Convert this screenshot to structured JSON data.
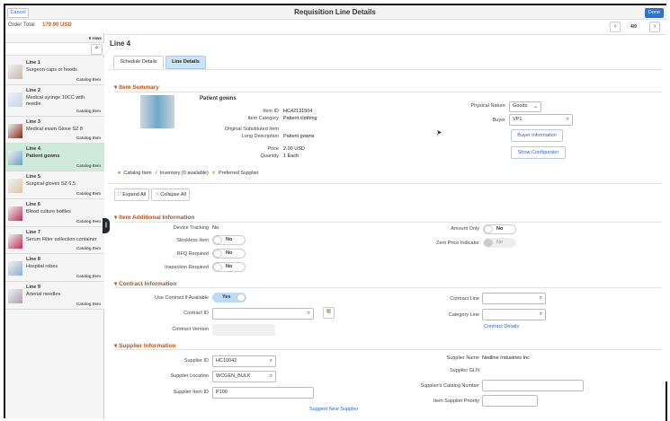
{
  "header": {
    "cancel": "Cancel",
    "title": "Requisition Line Details",
    "done": "Done"
  },
  "order_total": {
    "label": "Order Total",
    "value": "179.90 USD"
  },
  "list": {
    "rows": "9 rows",
    "items": [
      {
        "line": "Line 1",
        "desc": "Surgeon caps or hoods",
        "type": "Catalog Item"
      },
      {
        "line": "Line 2",
        "desc": "Medical syringe 10CC with needle",
        "type": "Catalog Item"
      },
      {
        "line": "Line 3",
        "desc": "Medical exam Glove SZ 8",
        "type": "Catalog Item"
      },
      {
        "line": "Line 4",
        "desc": "Patient gowns",
        "type": "Catalog Item"
      },
      {
        "line": "Line 5",
        "desc": "Surgical gloves SZ 6.5",
        "type": "Catalog Item"
      },
      {
        "line": "Line 6",
        "desc": "Blood culture bottles",
        "type": "Catalog Item"
      },
      {
        "line": "Line 7",
        "desc": "Serum Filter collection container",
        "type": "Catalog Item"
      },
      {
        "line": "Line 8",
        "desc": "Hospital robes",
        "type": "Catalog Item"
      },
      {
        "line": "Line 9",
        "desc": "Arterial needles",
        "type": "Catalog Item"
      }
    ]
  },
  "main": {
    "title": "Line 4",
    "pager": "4/9",
    "tabs": [
      "Schedule Details",
      "Line Details"
    ]
  },
  "summary": {
    "section": "Item Summary",
    "name": "Patient gowns",
    "item_id_label": "Item ID",
    "item_id": "HC42131504",
    "category_label": "Item Category",
    "category": "Patient clothing",
    "orig_label": "Original Substituted Item",
    "longdesc_label": "Long Description",
    "longdesc": "Patient gowns",
    "price_label": "Price",
    "price": "2.00 USD",
    "qty_label": "Quantity",
    "qty": "1 Each",
    "nature_label": "Physical Nature",
    "nature": "Goods",
    "buyer_label": "Buyer",
    "buyer": "VP1",
    "buyer_info": "Buyer Information",
    "show_config": "Show Configurator",
    "legend": [
      "Catalog Item",
      "Inventory (0 available)",
      "Preferred Supplier"
    ],
    "expand": "Expand All",
    "collapse": "Collapse All"
  },
  "additional": {
    "section": "Item Additional Information",
    "device_label": "Device Tracking",
    "device": "No",
    "stockless_label": "Stockless Item",
    "stockless": "No",
    "rfq_label": "RFQ Required",
    "rfq": "No",
    "insp_label": "Inspection Required",
    "insp": "No",
    "amount_label": "Amount Only",
    "amount": "No",
    "zero_label": "Zero Price Indicator",
    "zero": "No"
  },
  "contract": {
    "section": "Contract Information",
    "use_label": "Use Contract if Available",
    "use": "Yes",
    "id_label": "Contract ID",
    "id": "",
    "version_label": "Contract Version",
    "line_label": "Contract Line",
    "category_label": "Category Line",
    "details": "Contract Details"
  },
  "supplier": {
    "section": "Supplier Information",
    "id_label": "Supplier ID",
    "id": "HC10042",
    "loc_label": "Supplier Location",
    "loc": "WCGEN_BULK",
    "item_label": "Supplier Item ID",
    "item": "P100",
    "suggest": "Suggest New Supplier",
    "name_label": "Supplier Name",
    "name": "Nedline Industries Inc",
    "gln_label": "Supplier GLN",
    "catnum_label": "Supplier's Catalog Number",
    "prio_label": "Item Supplier Priority"
  },
  "colors": {
    "accent": "#2a66c8",
    "section": "#b3531d",
    "selected": "#cdebd8"
  }
}
